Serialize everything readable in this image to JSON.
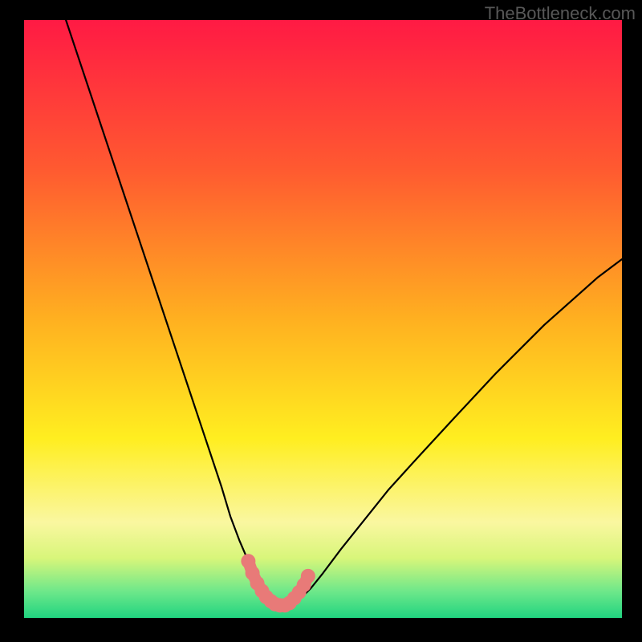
{
  "watermark": "TheBottleneck.com",
  "chart_data": {
    "type": "line",
    "title": "",
    "xlabel": "",
    "ylabel": "",
    "xlim": [
      0,
      100
    ],
    "ylim": [
      0,
      100
    ],
    "grid": false,
    "legend": false,
    "gradient_stops": [
      {
        "offset": 0.0,
        "color": "#ff1a44"
      },
      {
        "offset": 0.25,
        "color": "#ff5a30"
      },
      {
        "offset": 0.5,
        "color": "#ffb020"
      },
      {
        "offset": 0.7,
        "color": "#ffee20"
      },
      {
        "offset": 0.84,
        "color": "#faf7a0"
      },
      {
        "offset": 0.9,
        "color": "#d8f67a"
      },
      {
        "offset": 0.955,
        "color": "#6fe88a"
      },
      {
        "offset": 1.0,
        "color": "#20d480"
      }
    ],
    "series": [
      {
        "name": "bottleneck-curve",
        "color": "#000000",
        "x": [
          7,
          9,
          11,
          13,
          15,
          17,
          19,
          21,
          23,
          25,
          27,
          29,
          31,
          33,
          34.5,
          36,
          37.5,
          39,
          40,
          41,
          42,
          43,
          44,
          45,
          46.5,
          48,
          50,
          53,
          57,
          61,
          66,
          72,
          79,
          87,
          96,
          100
        ],
        "values": [
          100,
          94,
          88,
          82,
          76,
          70,
          64,
          58,
          52,
          46,
          40,
          34,
          28,
          22,
          17,
          13,
          9.5,
          6.5,
          4.5,
          3.3,
          2.5,
          2.1,
          2.1,
          2.5,
          3.5,
          5,
          7.5,
          11.5,
          16.5,
          21.5,
          27,
          33.5,
          41,
          49,
          57,
          60
        ]
      },
      {
        "name": "valley-highlight",
        "color": "#e87a78",
        "x": [
          37.5,
          38.2,
          39,
          39.8,
          40.5,
          41.3,
          42,
          42.8,
          43.6,
          44.4,
          45.2,
          46,
          46.8,
          47.5
        ],
        "values": [
          9.5,
          7.5,
          5.8,
          4.5,
          3.5,
          2.8,
          2.3,
          2.1,
          2.1,
          2.5,
          3.3,
          4.3,
          5.5,
          7
        ]
      }
    ]
  }
}
